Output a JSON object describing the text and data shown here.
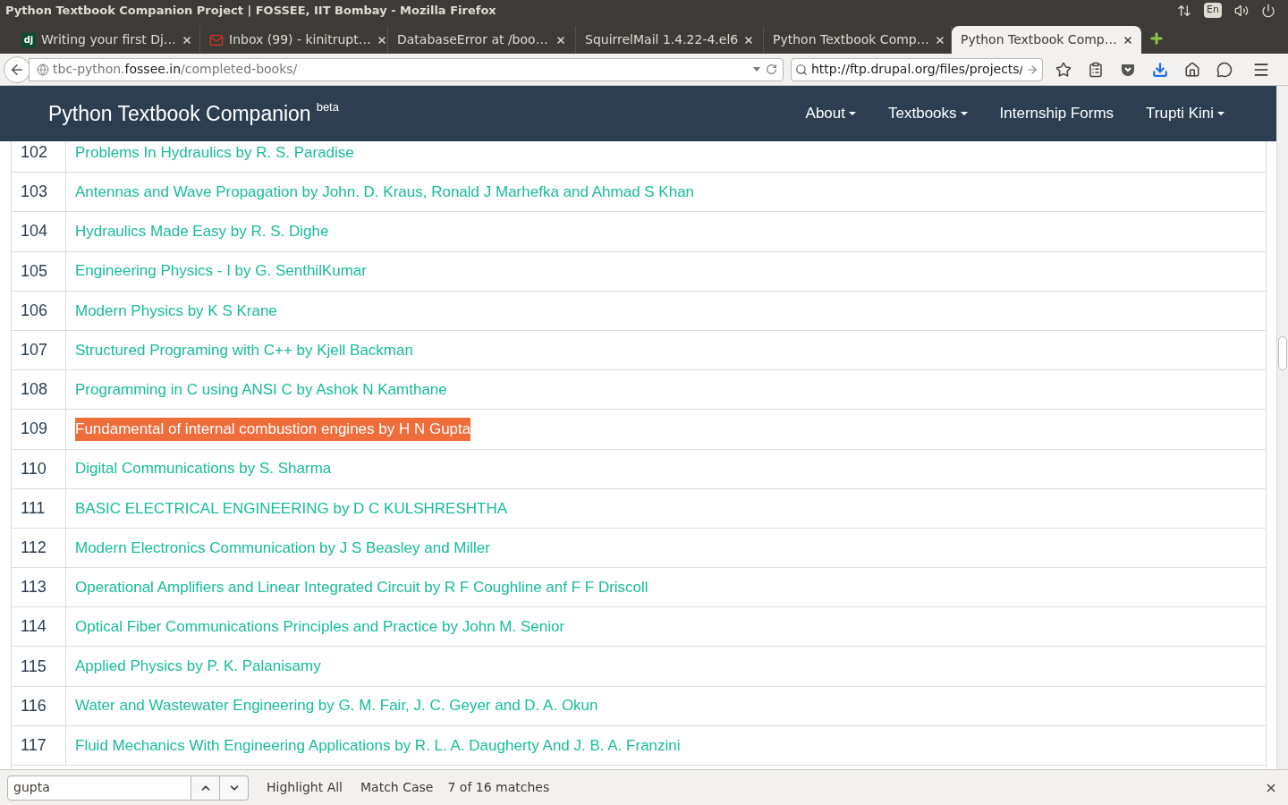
{
  "window": {
    "title": "Python Textbook Companion Project | FOSSEE, IIT Bombay - Mozilla Firefox",
    "indicators": {
      "language": "En"
    }
  },
  "tabs": [
    {
      "kind": "lettered",
      "favicon_text": "dj",
      "label": "Writing your first Dj…",
      "selected": false
    },
    {
      "kind": "mail",
      "label": "Inbox (99) - kinitrupt…",
      "selected": false
    },
    {
      "kind": "plain",
      "label": "DatabaseError at /boo…",
      "selected": false
    },
    {
      "kind": "plain",
      "label": "SquirrelMail 1.4.22-4.el6",
      "selected": false
    },
    {
      "kind": "plain",
      "label": "Python Textbook Comp…",
      "selected": false
    },
    {
      "kind": "plain",
      "label": "Python Textbook Comp…",
      "selected": true
    }
  ],
  "address_bar": {
    "subdomain": "tbc-python.",
    "domain": "fossee.in",
    "path": "/completed-books/"
  },
  "search_bar": {
    "value": "http://ftp.drupal.org/files/projects/"
  },
  "site": {
    "brand": "Python Textbook Companion",
    "badge": "beta",
    "nav": [
      {
        "label": "About",
        "dropdown": true
      },
      {
        "label": "Textbooks",
        "dropdown": true
      },
      {
        "label": "Internship Forms",
        "dropdown": false
      },
      {
        "label": "Trupti Kini",
        "dropdown": true
      }
    ]
  },
  "table": {
    "rows": [
      {
        "number": "102",
        "title": "Problems In Hydraulics by R. S. Paradise",
        "highlighted": false
      },
      {
        "number": "103",
        "title": "Antennas and Wave Propagation by John. D. Kraus, Ronald J Marhefka and Ahmad S Khan",
        "highlighted": false
      },
      {
        "number": "104",
        "title": "Hydraulics Made Easy by R. S. Dighe",
        "highlighted": false
      },
      {
        "number": "105",
        "title": "Engineering Physics - I by G. SenthilKumar",
        "highlighted": false
      },
      {
        "number": "106",
        "title": "Modern Physics by K S Krane",
        "highlighted": false
      },
      {
        "number": "107",
        "title": "Structured Programing with C++ by Kjell Backman",
        "highlighted": false
      },
      {
        "number": "108",
        "title": "Programming in C using ANSI C by Ashok N Kamthane",
        "highlighted": false
      },
      {
        "number": "109",
        "title": "Fundamental of internal combustion engines by H N Gupta",
        "highlighted": true
      },
      {
        "number": "110",
        "title": "Digital Communications by S. Sharma",
        "highlighted": false
      },
      {
        "number": "111",
        "title": "BASIC ELECTRICAL ENGINEERING by D C KULSHRESHTHA",
        "highlighted": false
      },
      {
        "number": "112",
        "title": "Modern Electronics Communication by J S Beasley and Miller",
        "highlighted": false
      },
      {
        "number": "113",
        "title": "Operational Amplifiers and Linear Integrated Circuit by R F Coughline anf F F Driscoll",
        "highlighted": false
      },
      {
        "number": "114",
        "title": "Optical Fiber Communications Principles and Practice by John M. Senior",
        "highlighted": false
      },
      {
        "number": "115",
        "title": "Applied Physics by P. K. Palanisamy",
        "highlighted": false
      },
      {
        "number": "116",
        "title": "Water and Wastewater Engineering by G. M. Fair, J. C. Geyer and D. A. Okun",
        "highlighted": false
      },
      {
        "number": "117",
        "title": "Fluid Mechanics With Engineering Applications by R. L. A. Daugherty And J. B. A. Franzini",
        "highlighted": false
      }
    ]
  },
  "find_bar": {
    "value": "gupta",
    "options": [
      "Highlight All",
      "Match Case"
    ],
    "status": "7 of 16 matches"
  }
}
